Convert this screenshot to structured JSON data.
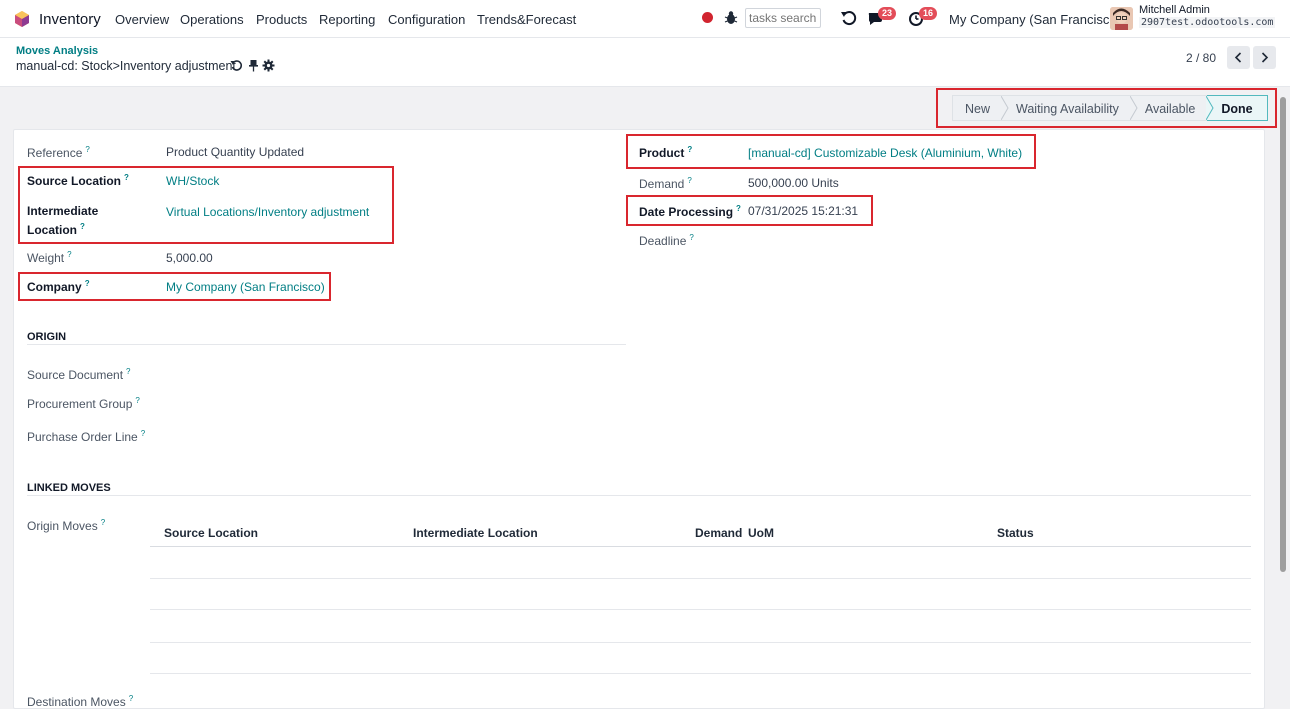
{
  "topbar": {
    "app_name": "Inventory",
    "menu": [
      "Overview",
      "Operations",
      "Products",
      "Reporting",
      "Configuration",
      "Trends&Forecast"
    ],
    "search_placeholder": "tasks search",
    "messages_count": "23",
    "activities_count": "16",
    "company": "My Company (San Francisco)",
    "user_name": "Mitchell Admin",
    "database": "2907test.odootools.com",
    "colors": {
      "badge": "#e34d59",
      "record_dot": "#d1242f"
    }
  },
  "breadcrumb": {
    "parent": "Moves Analysis",
    "current": "manual-cd: Stock>Inventory adjustment"
  },
  "pager": {
    "value": "2 / 80"
  },
  "status": {
    "stages": [
      "New",
      "Waiting Availability",
      "Available",
      "Done"
    ],
    "active": "Done"
  },
  "form": {
    "reference": {
      "label": "Reference",
      "value": "Product Quantity Updated"
    },
    "source_location": {
      "label": "Source Location",
      "value": "WH/Stock"
    },
    "intermediate_location": {
      "label_line1": "Intermediate",
      "label_line2": "Location",
      "value": "Virtual Locations/Inventory adjustment"
    },
    "weight": {
      "label": "Weight",
      "value": "5,000.00"
    },
    "company": {
      "label": "Company",
      "value": "My Company (San Francisco)"
    },
    "product": {
      "label": "Product",
      "value": "[manual-cd] Customizable Desk (Aluminium, White)"
    },
    "demand": {
      "label": "Demand",
      "value": "500,000.00 Units"
    },
    "date_processing": {
      "label": "Date Processing",
      "value": "07/31/2025 15:21:31"
    },
    "deadline": {
      "label": "Deadline"
    },
    "help_mark": "?"
  },
  "origin": {
    "title": "ORIGIN",
    "source_document": "Source Document",
    "procurement_group": "Procurement Group",
    "purchase_order_line": "Purchase Order Line"
  },
  "linked_moves": {
    "title": "LINKED MOVES",
    "origin_moves": "Origin Moves",
    "destination_moves": "Destination Moves",
    "columns": [
      "Source Location",
      "Intermediate Location",
      "Demand",
      "UoM",
      "Status"
    ]
  },
  "accent_color": "#017e84",
  "highlight_color": "#d9262e"
}
